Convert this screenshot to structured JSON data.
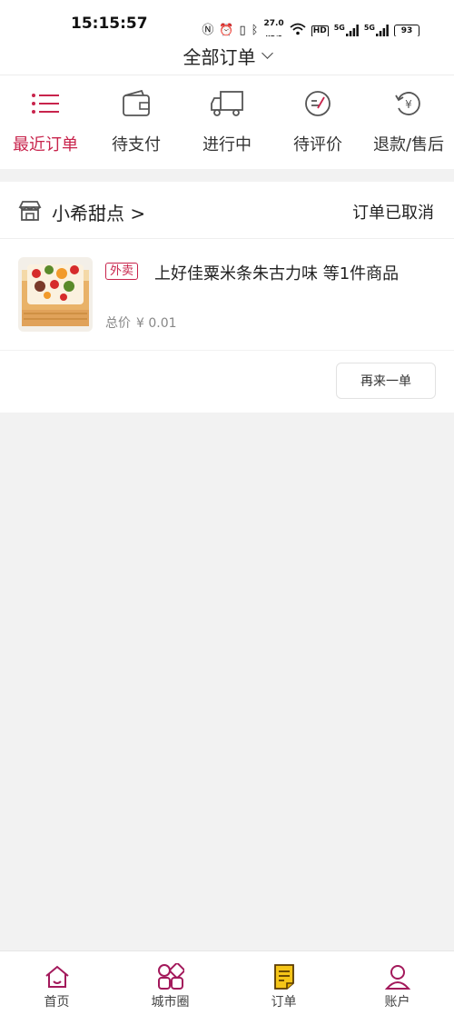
{
  "status_bar": {
    "time": "15:15:57",
    "speed_value": "27.0",
    "speed_unit": "KB/S",
    "hd": "HD",
    "signal1": "5G",
    "signal2": "5G",
    "battery": "93"
  },
  "header": {
    "title": "全部订单"
  },
  "tabs": [
    {
      "label": "最近订单",
      "icon": "list-icon",
      "active": true
    },
    {
      "label": "待支付",
      "icon": "wallet-icon",
      "active": false
    },
    {
      "label": "进行中",
      "icon": "truck-icon",
      "active": false
    },
    {
      "label": "待评价",
      "icon": "review-icon",
      "active": false
    },
    {
      "label": "退款/售后",
      "icon": "refund-icon",
      "active": false
    }
  ],
  "order": {
    "shop_name": "小希甜点 >",
    "status": "订单已取消",
    "tag": "外卖",
    "title": "上好佳粟米条朱古力味 等1件商品",
    "total_label": "总价",
    "total_amount": "¥ 0.01",
    "reorder_label": "再来一单"
  },
  "bottom_nav": [
    {
      "label": "首页",
      "icon": "home-icon"
    },
    {
      "label": "城市圈",
      "icon": "grid-icon"
    },
    {
      "label": "订单",
      "icon": "order-doc-icon"
    },
    {
      "label": "账户",
      "icon": "user-icon"
    }
  ],
  "colors": {
    "accent": "#c8244c",
    "background": "#f2f2f2",
    "order_icon_yellow": "#f5c518"
  }
}
